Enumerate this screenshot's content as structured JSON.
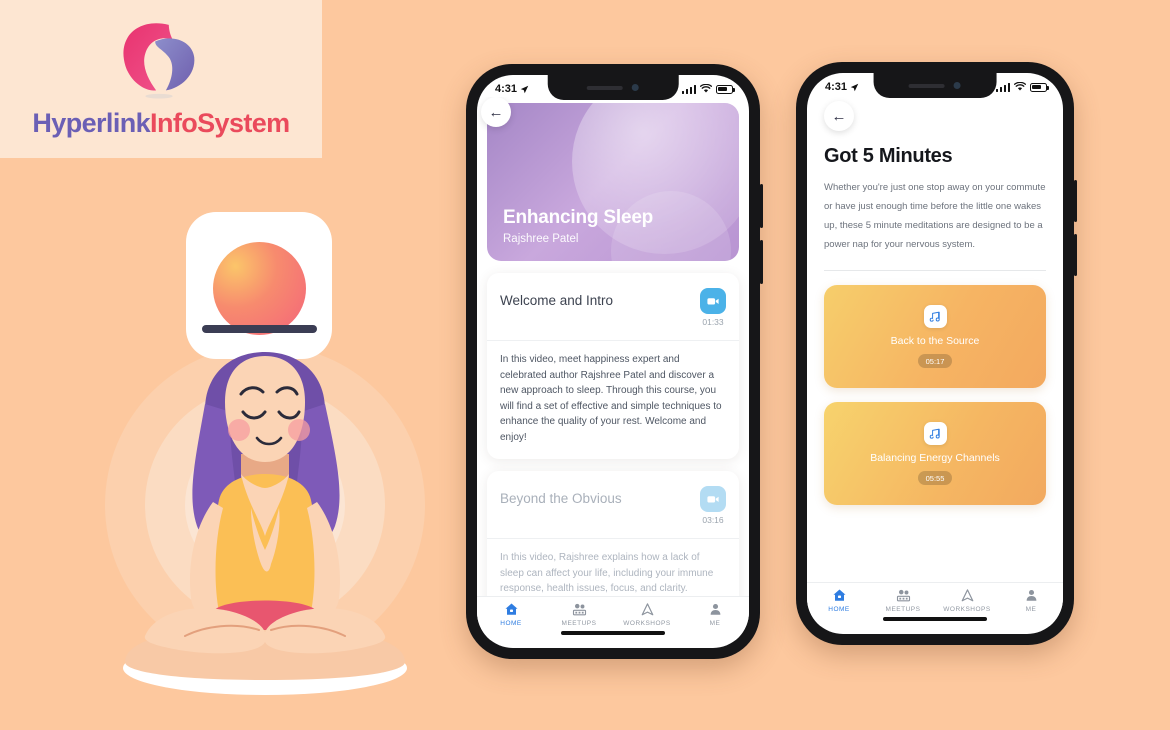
{
  "branding": {
    "company_name_part1": "Hyperlink",
    "company_name_part2": "InfoSystem",
    "logo_icon": "swirl-logo-icon",
    "colors": {
      "part1": "#6b5fb5",
      "part2": "#ea4a5c",
      "panel_bg": "#fde6d2"
    }
  },
  "page": {
    "background_color": "#fdc89e",
    "app_icon_name": "sunrise-app-icon",
    "illustration_name": "woman-meditating-lotus-pose"
  },
  "phone1": {
    "status_bar": {
      "time": "4:31",
      "location_icon": "location-arrow-icon",
      "signal_icon": "cellular-signal-icon",
      "wifi_icon": "wifi-icon",
      "battery_icon": "battery-icon"
    },
    "back_icon": "back-arrow-icon",
    "hero": {
      "title": "Enhancing Sleep",
      "subtitle": "Rajshree Patel",
      "image_name": "moon-gradient-image",
      "gradient_from": "#a486c6",
      "gradient_to": "#c9a8dd"
    },
    "lessons": [
      {
        "title": "Welcome and Intro",
        "duration": "01:33",
        "media_icon": "video-camera-icon",
        "description": "In this video, meet happiness expert and celebrated author Rajshree Patel and discover a new approach to sleep. Through this course, you will find a set of effective and simple techniques to enhance the quality of your rest. Welcome and enjoy!"
      },
      {
        "title": "Beyond the Obvious",
        "duration": "03:16",
        "media_icon": "video-camera-icon",
        "description": "In this video, Rajshree explains how a lack of sleep can affect your life, including your immune response, health issues, focus, and clarity. Rajshree poses a series of questions to"
      }
    ],
    "tabs": [
      {
        "label": "HOME",
        "icon": "home-icon",
        "active": true
      },
      {
        "label": "MEETUPS",
        "icon": "people-group-icon",
        "active": false
      },
      {
        "label": "WORKSHOPS",
        "icon": "compass-triangle-icon",
        "active": false
      },
      {
        "label": "ME",
        "icon": "person-icon",
        "active": false
      }
    ],
    "active_tab_color": "#2f7de1"
  },
  "phone2": {
    "status_bar": {
      "time": "4:31",
      "location_icon": "location-arrow-icon",
      "signal_icon": "cellular-signal-icon",
      "wifi_icon": "wifi-icon",
      "battery_icon": "battery-icon"
    },
    "back_icon": "back-arrow-icon",
    "title": "Got 5 Minutes",
    "description": "Whether you're just one stop away on your commute or have just enough time before the little one wakes up, these 5 minute meditations are designed to be a power nap for your nervous system.",
    "meditations": [
      {
        "title": "Back to the Source",
        "duration": "05:17",
        "media_icon": "music-note-icon",
        "gradient_from": "#f6ce6b",
        "gradient_to": "#f3a95f"
      },
      {
        "title": "Balancing Energy Channels",
        "duration": "05:55",
        "media_icon": "music-note-icon",
        "gradient_from": "#f7d36d",
        "gradient_to": "#f2a95f"
      }
    ],
    "tabs": [
      {
        "label": "HOME",
        "icon": "home-icon",
        "active": true
      },
      {
        "label": "MEETUPS",
        "icon": "people-group-icon",
        "active": false
      },
      {
        "label": "WORKSHOPS",
        "icon": "compass-triangle-icon",
        "active": false
      },
      {
        "label": "ME",
        "icon": "person-icon",
        "active": false
      }
    ]
  }
}
